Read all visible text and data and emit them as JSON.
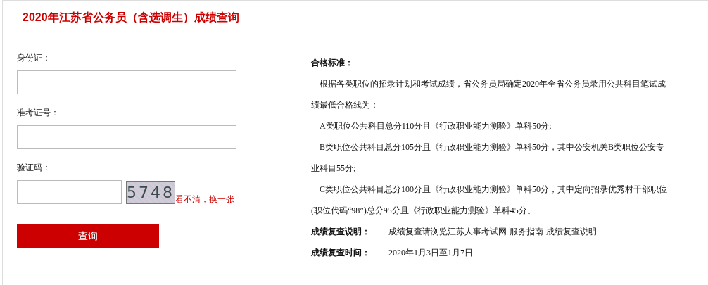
{
  "title": "2020年江苏省公务员（含选调生）成绩查询",
  "form": {
    "fields": [
      {
        "label": "身份证："
      },
      {
        "label": "准考证号："
      }
    ],
    "captcha": {
      "label": "验证码：",
      "code": "5748",
      "refresh_link": "看不清，换一张"
    },
    "submit": "查询"
  },
  "info": {
    "heading": "合格标准：",
    "paragraphs": [
      "根据各类职位的招录计划和考试成绩，省公务员局确定2020年全省公务员录用公共科目笔试成绩最低合格线为：",
      "A类职位公共科目总分110分且《行政职业能力测验》单科50分;",
      "B类职位公共科目总分105分且《行政职业能力测验》单科50分，其中公安机关B类职位公安专业科目55分;",
      "C类职位公共科目总分100分且《行政职业能力测验》单科50分，其中定向招录优秀村干部职位(职位代码“98”)总分95分且《行政职业能力测验》单科45分。"
    ],
    "notes": [
      {
        "label": "成绩复查说明：",
        "value": "成绩复查请浏览江苏人事考试网-服务指南-成绩复查说明"
      },
      {
        "label": "成绩复查时间：",
        "value": "2020年1月3日至1月7日"
      }
    ]
  }
}
